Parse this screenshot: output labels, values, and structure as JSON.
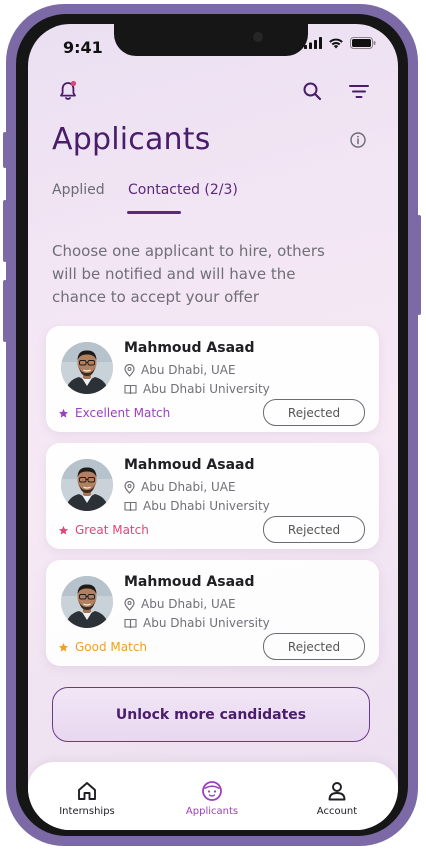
{
  "status_bar": {
    "time": "9:41"
  },
  "header": {
    "title": "Applicants",
    "icons": [
      "bell-icon",
      "search-icon",
      "filter-icon",
      "info-icon"
    ]
  },
  "tabs": [
    {
      "label": "Applied",
      "active": false
    },
    {
      "label": "Contacted (2/3)",
      "active": true
    }
  ],
  "instructions": "Choose one applicant to hire, others will be notified and will have the chance to accept your offer",
  "applicants": [
    {
      "name": "Mahmoud Asaad",
      "location": "Abu Dhabi, UAE",
      "university": "Abu Dhabi University",
      "match": "Excellent Match",
      "match_color": "#9b3fc0",
      "status": "Rejected"
    },
    {
      "name": "Mahmoud Asaad",
      "location": "Abu Dhabi, UAE",
      "university": "Abu Dhabi University",
      "match": "Great Match",
      "match_color": "#e0457a",
      "status": "Rejected"
    },
    {
      "name": "Mahmoud Asaad",
      "location": "Abu Dhabi, UAE",
      "university": "Abu Dhabi University",
      "match": "Good Match",
      "match_color": "#f0a020",
      "status": "Rejected"
    }
  ],
  "unlock_button": {
    "label": "Unlock more candidates"
  },
  "bottom_nav": [
    {
      "label": "Internships",
      "icon": "home-icon",
      "active": false
    },
    {
      "label": "Applicants",
      "icon": "face-icon",
      "active": true
    },
    {
      "label": "Account",
      "icon": "person-icon",
      "active": false
    }
  ],
  "colors": {
    "brand": "#4a1d6b",
    "accent": "#9b3fc0",
    "notification_dot": "#e0457a"
  }
}
